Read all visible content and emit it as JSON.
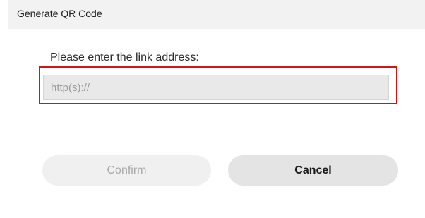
{
  "dialog": {
    "title": "Generate QR Code",
    "prompt": "Please enter the link address:",
    "url_input": {
      "value": "",
      "placeholder": "http(s)://"
    },
    "buttons": {
      "confirm_label": "Confirm",
      "cancel_label": "Cancel"
    },
    "colors": {
      "highlight_border": "#d61313",
      "title_bar_bg": "#f2f2f2",
      "input_bg": "#e9e9e9"
    }
  }
}
